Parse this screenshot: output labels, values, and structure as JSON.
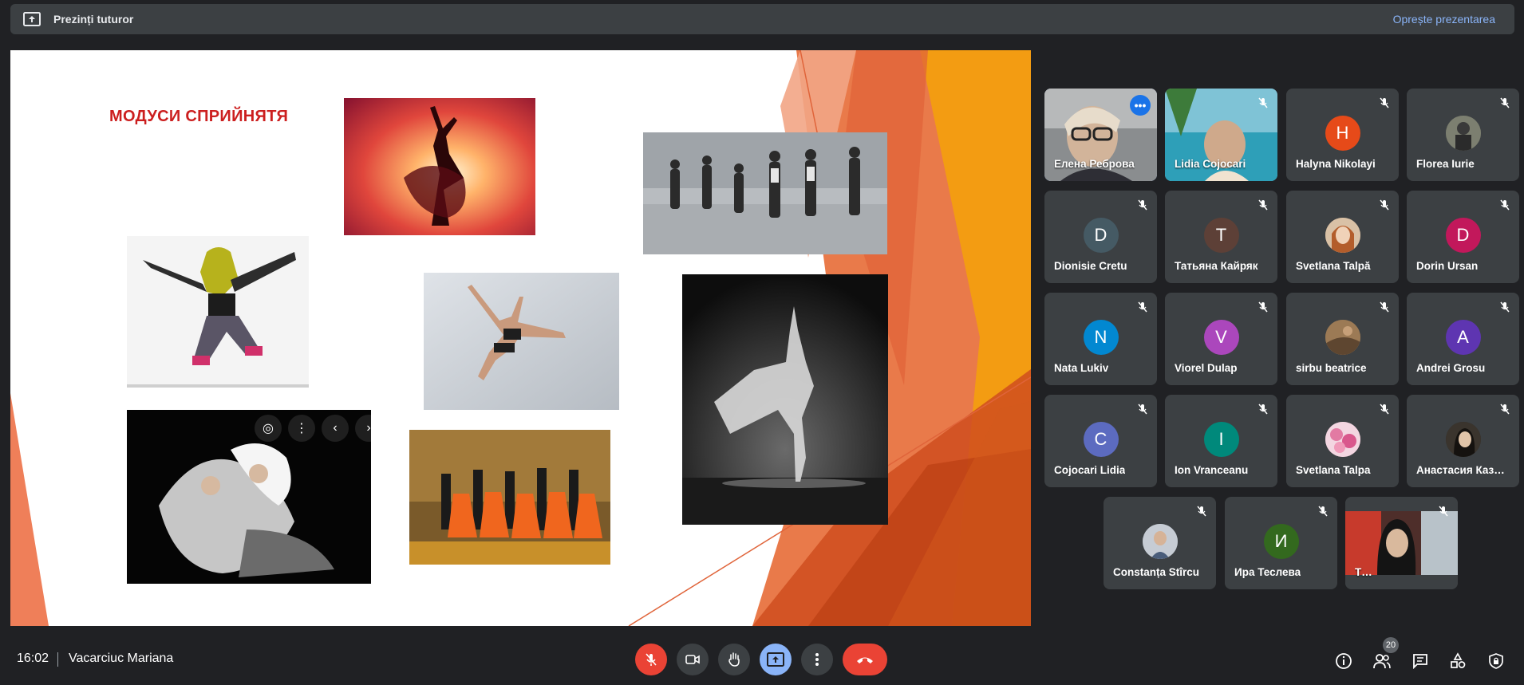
{
  "banner": {
    "label": "Prezinți tuturor",
    "stop_label": "Oprește prezentarea",
    "icon": "present-to-all-icon"
  },
  "slide": {
    "title": "МОДУСИ СПРИЙНЯТЯ",
    "images": [
      {
        "name": "dancer-sunset-photo"
      },
      {
        "name": "group-dance-class-photo"
      },
      {
        "name": "hip-hop-dancer-photo"
      },
      {
        "name": "ballet-leap-photo"
      },
      {
        "name": "black-white-dancer-photo"
      },
      {
        "name": "contemporary-dance-photo"
      },
      {
        "name": "ballroom-dancers-photo"
      }
    ]
  },
  "participants": [
    {
      "name": "Елена Реброва",
      "type": "video"
    },
    {
      "name": "Lidia Cojocari",
      "type": "video"
    },
    {
      "name": "Halyna Nikolayi",
      "initial": "H",
      "color": "#e64a19"
    },
    {
      "name": "Florea Iurie",
      "type": "photo"
    },
    {
      "name": "Dionisie Cretu",
      "initial": "D",
      "color": "#455a64"
    },
    {
      "name": "Татьяна Кайряк",
      "initial": "Т",
      "color": "#5d4037"
    },
    {
      "name": "Svetlana Talpă",
      "type": "photo"
    },
    {
      "name": "Dorin Ursan",
      "initial": "D",
      "color": "#c2185b"
    },
    {
      "name": "Nata Lukiv",
      "initial": "N",
      "color": "#0288d1"
    },
    {
      "name": "Viorel Dulap",
      "initial": "V",
      "color": "#ab47bc"
    },
    {
      "name": "sirbu beatrice",
      "type": "photo"
    },
    {
      "name": "Andrei Grosu",
      "initial": "A",
      "color": "#5e35b1"
    },
    {
      "name": "Cojocari Lidia",
      "initial": "C",
      "color": "#5c6bc0"
    },
    {
      "name": "Ion Vranceanu",
      "initial": "I",
      "color": "#00897b"
    },
    {
      "name": "Svetlana Talpa",
      "type": "photo"
    },
    {
      "name": "Анастасия Каз…",
      "type": "photo"
    },
    {
      "name": "Constanța Stîrcu",
      "type": "photo"
    },
    {
      "name": "Ира Теслева",
      "initial": "И",
      "color": "#33691e"
    },
    {
      "name": "Т…",
      "type": "video"
    }
  ],
  "bottom": {
    "time": "16:02",
    "meeting_name": "Vacarciuc Mariana",
    "people_count": "20"
  },
  "colors": {
    "background": "#202124",
    "tile": "#3c4043",
    "accent": "#8ab4f8",
    "danger": "#ea4335",
    "slide_title": "#cc1f1f"
  }
}
